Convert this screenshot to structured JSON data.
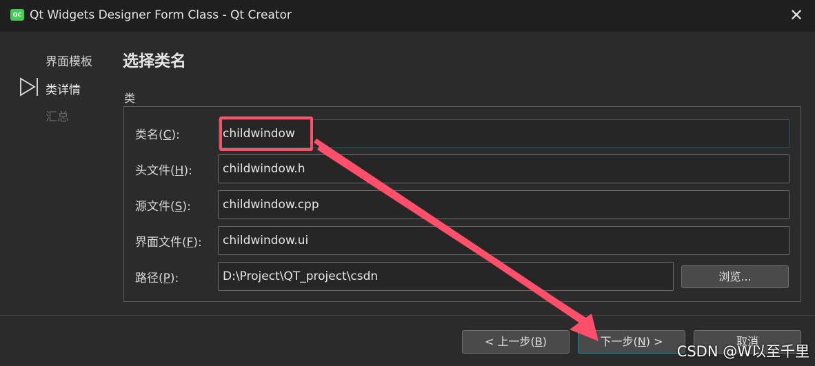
{
  "window": {
    "app_icon_text": "QC",
    "title": "Qt Widgets Designer Form Class - Qt Creator",
    "close_glyph": "✕"
  },
  "wizard_steps": [
    {
      "label": "界面模板",
      "state": "done"
    },
    {
      "label": "类详情",
      "state": "current"
    },
    {
      "label": "汇总",
      "state": "pending"
    }
  ],
  "page": {
    "title": "选择类名",
    "group_title": "类"
  },
  "fields": {
    "class_name": {
      "label_pre": "类名(",
      "mnemonic": "C",
      "label_post": "):",
      "value": "childwindow"
    },
    "header_file": {
      "label_pre": "头文件(",
      "mnemonic": "H",
      "label_post": "):",
      "value": "childwindow.h"
    },
    "source_file": {
      "label_pre": "源文件(",
      "mnemonic": "S",
      "label_post": "):",
      "value": "childwindow.cpp"
    },
    "form_file": {
      "label_pre": "界面文件(",
      "mnemonic": "F",
      "label_post": "):",
      "value": "childwindow.ui"
    },
    "path": {
      "label_pre": "路径(",
      "mnemonic": "P",
      "label_post": "):",
      "value": "D:\\Project\\QT_project\\csdn"
    }
  },
  "buttons": {
    "browse": "浏览...",
    "back_pre": "< 上一步(",
    "back_mnemonic": "B",
    "back_post": ")",
    "next_pre": "下一步(",
    "next_mnemonic": "N",
    "next_post": ") >",
    "cancel": "取消"
  },
  "annotation": {
    "color": "#ff4f6a",
    "icon": "arrow-annotation"
  },
  "watermark": "CSDN @W以至千里",
  "colors": {
    "background": "#2b2b2b",
    "titlebar": "#1f1f1f",
    "focus_border": "#2f7f86",
    "app_icon": "#41cd52"
  }
}
